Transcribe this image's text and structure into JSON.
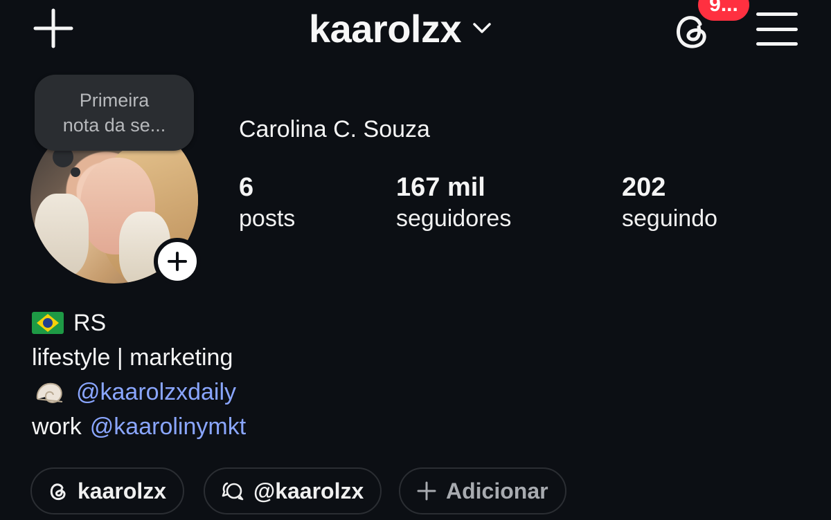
{
  "header": {
    "username": "kaarolzx",
    "notification_badge": "9...",
    "icons": {
      "create": "plus-icon",
      "account_switcher": "chevron-down-icon",
      "threads": "threads-icon",
      "menu": "hamburger-menu-icon"
    }
  },
  "note": {
    "line1": "Primeira",
    "line2": "nota da se..."
  },
  "profile": {
    "full_name": "Carolina C. Souza",
    "stats": [
      {
        "value": "6",
        "label": "posts"
      },
      {
        "value": "167 mil",
        "label": "seguidores"
      },
      {
        "value": "202",
        "label": "seguindo"
      }
    ]
  },
  "bio": {
    "line1": "RS",
    "line2": "lifestyle | marketing",
    "line3_handle": "@kaarolzxdaily",
    "line4_prefix": "work",
    "line4_handle": "@kaarolinymkt"
  },
  "chips": [
    {
      "label": "kaarolzx",
      "icon": "threads-icon"
    },
    {
      "label": "@kaarolzx",
      "icon": "message-bubble-icon"
    },
    {
      "label": "Adicionar",
      "icon": "plus-icon"
    }
  ],
  "colors": {
    "background": "#0c0f14",
    "link": "#8aa6ff",
    "badge": "#ff3040",
    "note_bubble": "#2a2d31"
  }
}
